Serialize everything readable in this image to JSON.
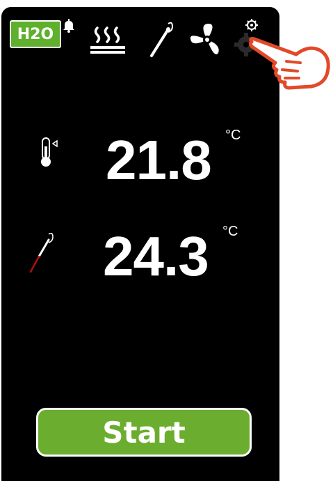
{
  "status_bar": {
    "h2o_label": "H2O",
    "icons": [
      "bell-icon",
      "steam-heat-icon",
      "core-probe-icon",
      "fan-icon",
      "settings-gear-icon"
    ]
  },
  "readings": [
    {
      "icon": "thermometer-icon",
      "value": "21.8",
      "unit": "°C"
    },
    {
      "icon": "core-probe-icon",
      "value": "24.3",
      "unit": "°C"
    }
  ],
  "start_button": {
    "label": "Start"
  },
  "overlay": {
    "icon": "pointing-hand-icon",
    "color": "#e2492a"
  },
  "colors": {
    "screen_bg": "#000000",
    "accent_green": "#6bad2f",
    "probe_tip_red": "#b01010",
    "text": "#ffffff"
  }
}
